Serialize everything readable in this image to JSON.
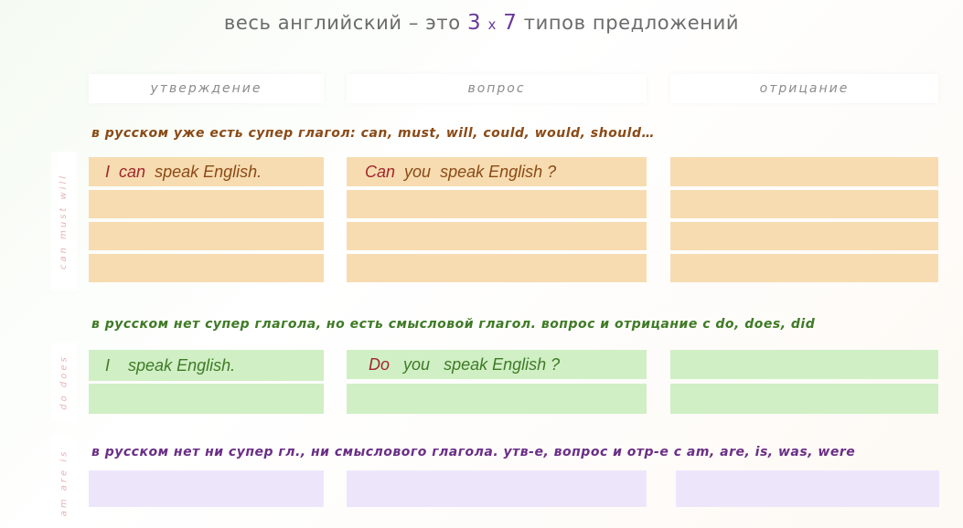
{
  "title": {
    "prefix": "весь английский – это ",
    "n1": "3",
    "x": "x",
    "n2": "7",
    "suffix": " типов предложений"
  },
  "columns": [
    "утверждение",
    "вопрос",
    "отрицание"
  ],
  "sections": [
    {
      "text": "в русском уже есть супер глагол: can, must, will, could, would, should…",
      "color": "#8a4a16",
      "side_label": "can   must   will",
      "rows": [
        {
          "affirm_subject": "I",
          "affirm_modal": "can",
          "affirm_rest": "speak English.",
          "question_modal": "Can",
          "question_subject": "you",
          "question_rest": "speak English ?"
        }
      ]
    },
    {
      "text": "в русском нет супер глагола, но есть смысловой глагол. вопрос и отрицание с do, does, did",
      "color": "#3f7a26",
      "side_label": "do   does",
      "rows": [
        {
          "affirm_subject": "I",
          "affirm_rest": "speak English.",
          "question_aux": "Do",
          "question_subject": "you",
          "question_rest": "speak English ?"
        }
      ]
    },
    {
      "text": "в русском нет ни супер гл., ни смыслового глагола. утв-е, вопрос и отр-е с am, are, is, was, were",
      "color": "#6a2f86",
      "side_label": "am   are   is"
    }
  ]
}
